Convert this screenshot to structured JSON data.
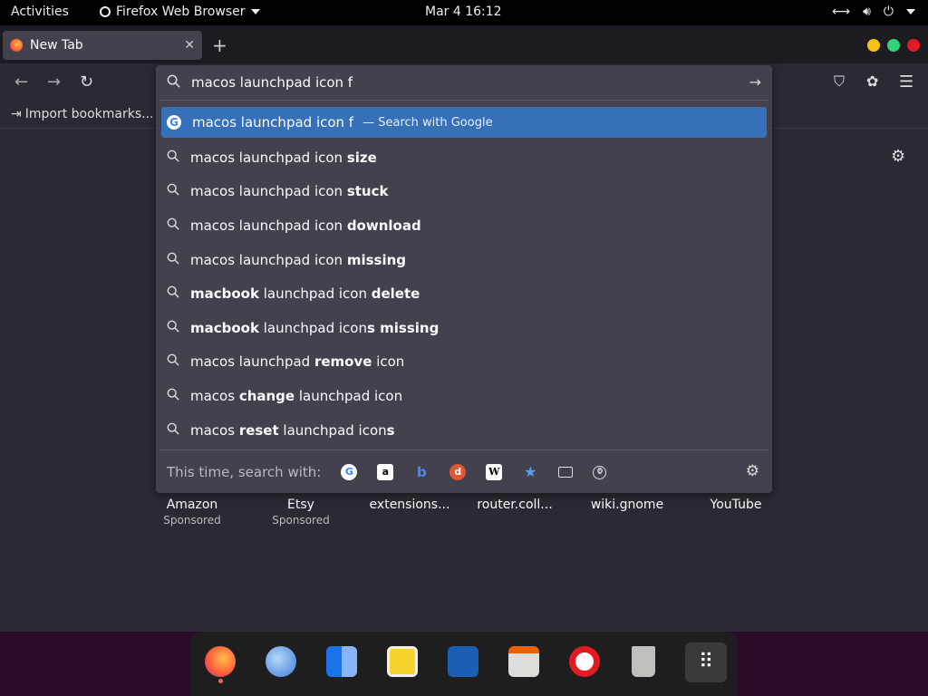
{
  "topbar": {
    "activities": "Activities",
    "app_name": "Firefox Web Browser",
    "clock": "Mar 4  16:12"
  },
  "tab": {
    "title": "New Tab"
  },
  "bookmarks": {
    "import_label": "Import bookmarks..."
  },
  "urlbar": {
    "query": "macos launchpad icon f"
  },
  "suggestions": [
    {
      "text": "macos launchpad icon f",
      "hint": "— Search with Google"
    },
    {
      "parts": [
        [
          "macos launchpad icon ",
          false
        ],
        [
          "size",
          true
        ]
      ]
    },
    {
      "parts": [
        [
          "macos launchpad icon ",
          false
        ],
        [
          "stuck",
          true
        ]
      ]
    },
    {
      "parts": [
        [
          "macos launchpad icon ",
          false
        ],
        [
          "download",
          true
        ]
      ]
    },
    {
      "parts": [
        [
          "macos launchpad icon ",
          false
        ],
        [
          "missing",
          true
        ]
      ]
    },
    {
      "parts": [
        [
          "macbook",
          true
        ],
        [
          " launchpad icon ",
          false
        ],
        [
          "delete",
          true
        ]
      ]
    },
    {
      "parts": [
        [
          "macbook",
          true
        ],
        [
          " launchpad icon",
          false
        ],
        [
          "s missing",
          true
        ]
      ]
    },
    {
      "parts": [
        [
          "macos launchpad ",
          false
        ],
        [
          "remove",
          true
        ],
        [
          " icon",
          false
        ]
      ]
    },
    {
      "parts": [
        [
          "macos ",
          false
        ],
        [
          "change",
          true
        ],
        [
          " launchpad icon",
          false
        ]
      ]
    },
    {
      "parts": [
        [
          "macos ",
          false
        ],
        [
          "reset",
          true
        ],
        [
          " launchpad icon",
          false
        ],
        [
          "s",
          true
        ]
      ]
    }
  ],
  "engines": {
    "label": "This time, search with:",
    "items": [
      "google-icon",
      "amazon-icon",
      "bing-icon",
      "duckduckgo-icon",
      "wikipedia-icon",
      "bookmarks-icon",
      "tabs-icon",
      "history-icon"
    ]
  },
  "tiles": [
    {
      "name": "Amazon",
      "sub": "Sponsored"
    },
    {
      "name": "Etsy",
      "sub": "Sponsored"
    },
    {
      "name": "extensions...",
      "sub": ""
    },
    {
      "name": "router.coll...",
      "sub": ""
    },
    {
      "name": "wiki.gnome",
      "sub": ""
    },
    {
      "name": "YouTube",
      "sub": ""
    }
  ],
  "colors": {
    "accent": "#3570b8",
    "dock_bg": "#2c0a2a"
  }
}
